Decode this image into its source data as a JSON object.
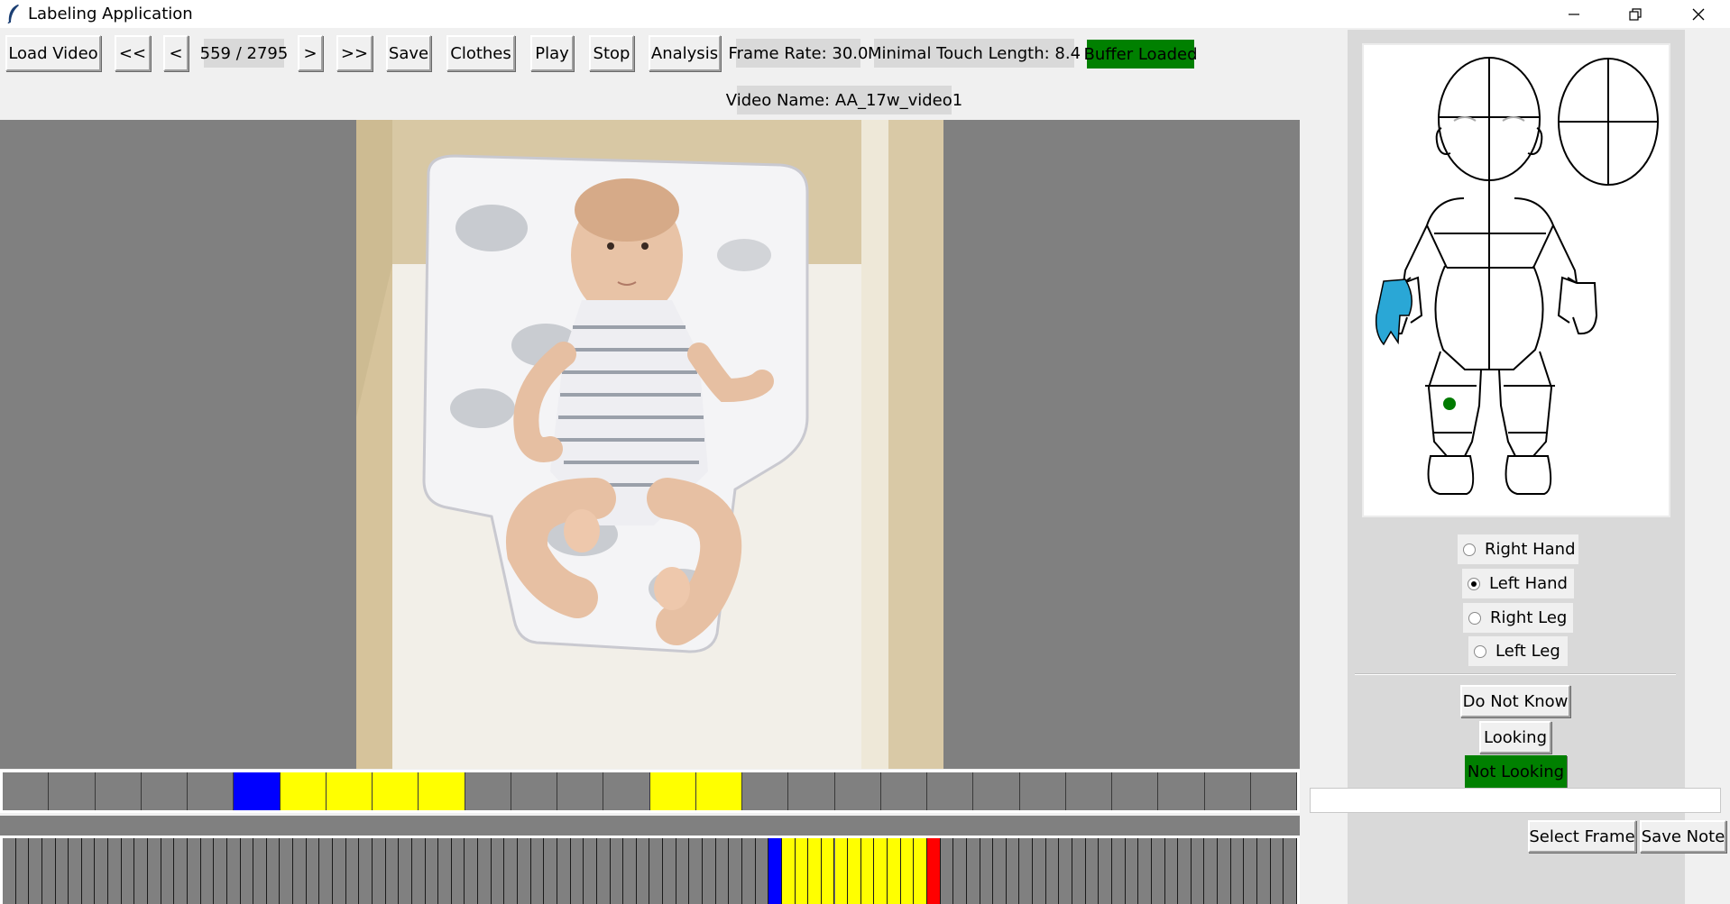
{
  "window": {
    "title": "Labeling Application",
    "icon": "feather-icon",
    "controls": [
      "minimize-icon",
      "restore-icon",
      "close-icon"
    ]
  },
  "toolbar": {
    "load_video": "Load Video",
    "first": "<<",
    "prev": "<",
    "frame_counter": "559 / 2795",
    "next": ">",
    "last": ">>",
    "save": "Save",
    "clothes": "Clothes",
    "play": "Play",
    "stop": "Stop",
    "analysis": "Analysis",
    "frame_rate": "Frame Rate: 30.0",
    "min_touch": "Minimal Touch Length: 8.4",
    "buffer_status": "Buffer Loaded",
    "video_name": "Video Name: AA_17w_video1"
  },
  "colors": {
    "buffer_bg": "#008000",
    "selected_part": "#2aa7d6",
    "touch_dot": "#007a00",
    "current": "#0000ff",
    "touch": "#ffff00",
    "end": "#ff0000",
    "grey": "#808080"
  },
  "timeline1": {
    "cells": [
      "grey",
      "grey",
      "grey",
      "grey",
      "grey",
      "blue",
      "yellow",
      "yellow",
      "yellow",
      "yellow",
      "grey",
      "grey",
      "grey",
      "grey",
      "yellow",
      "yellow",
      "grey",
      "grey",
      "grey",
      "grey",
      "grey",
      "grey",
      "grey",
      "grey",
      "grey",
      "grey",
      "grey",
      "grey"
    ]
  },
  "timeline2": {
    "highlighted": {
      "blue_at": 58,
      "yellow_from": 59,
      "yellow_to": 69,
      "red_at": 70
    },
    "count": 98
  },
  "body_parts": {
    "options": [
      {
        "label": "Right Hand",
        "checked": false
      },
      {
        "label": "Left Hand",
        "checked": true
      },
      {
        "label": "Right Leg",
        "checked": false
      },
      {
        "label": "Left Leg",
        "checked": false
      }
    ]
  },
  "gaze": {
    "do_not_know": "Do Not Know",
    "looking": "Looking",
    "not_looking": "Not Looking"
  },
  "note": {
    "value": "",
    "select_frame": "Select Frame",
    "save_note": "Save Note"
  }
}
